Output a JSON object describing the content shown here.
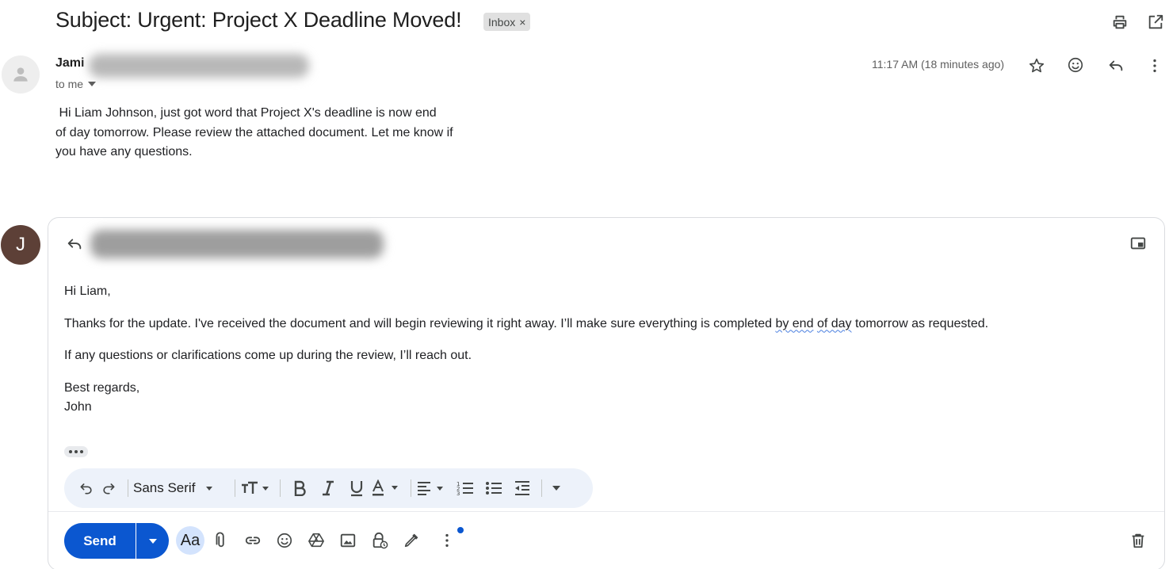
{
  "header": {
    "subject": "Subject: Urgent: Project X Deadline Moved!",
    "label_chip": "Inbox",
    "label_remove": "×"
  },
  "message": {
    "sender_name": "Jami",
    "recipient": "to me",
    "time": "11:17 AM (18 minutes ago)",
    "body_lines": [
      " Hi Liam Johnson, just got word that Project X's deadline is now end",
      "of day tomorrow. Please review the attached document. Let me know if",
      "you have any questions."
    ]
  },
  "compose": {
    "avatar_letter": "J",
    "greeting": "Hi Liam,",
    "para1_before": "Thanks for the update. I've received the document and will begin reviewing it right away. I’ll make sure everything is completed ",
    "para1_flag1": "by end",
    "para1_space": " ",
    "para1_flag2": "of day",
    "para1_after": " tomorrow as requested.",
    "para2": "If any questions or clarifications come up during the review, I’ll reach out.",
    "signoff": "Best regards,",
    "signature": "John",
    "font_name": "Sans Serif",
    "send_label": "Send",
    "aa_label": "Aa"
  },
  "colors": {
    "send_blue": "#0b57d0",
    "avatar_brown": "#5d4037",
    "format_bar_bg": "#edf2fa"
  },
  "icons": [
    "print-icon",
    "open-new-window-icon",
    "star-icon",
    "emoji-icon",
    "reply-icon",
    "more-vert-icon",
    "popout-icon",
    "undo-icon",
    "redo-icon",
    "text-size-icon",
    "bold-icon",
    "italic-icon",
    "underline-icon",
    "text-color-icon",
    "align-icon",
    "numbered-list-icon",
    "bulleted-list-icon",
    "indent-less-icon",
    "attach-icon",
    "link-icon",
    "drive-icon",
    "photo-icon",
    "confidential-icon",
    "signature-icon",
    "trash-icon"
  ]
}
